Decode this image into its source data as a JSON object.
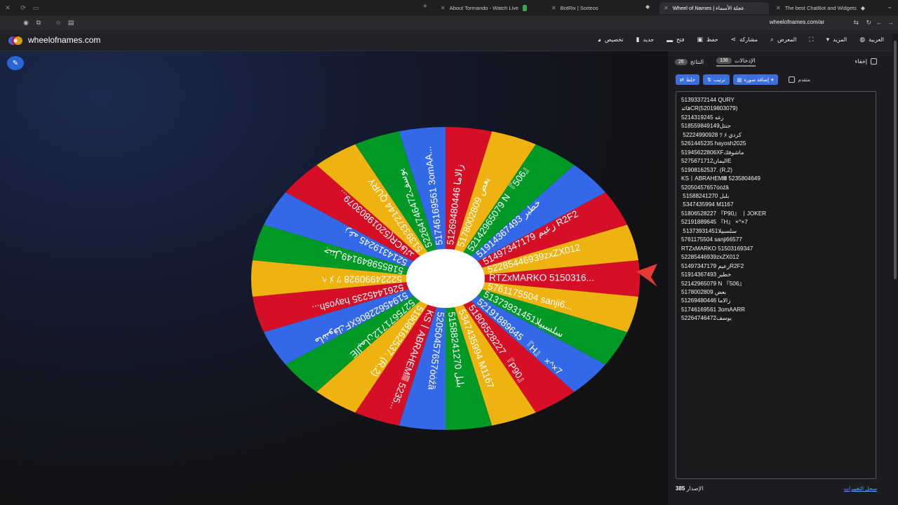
{
  "browser": {
    "tabs": [
      {
        "label": "About Tormando - Watch Live",
        "favicon_color": "#6a6a6a"
      },
      {
        "label": "BotRix | Sorteos",
        "favicon_color": "#3aa84a"
      },
      {
        "label": "Wheel of Names | عجلة الأسماء",
        "favicon_color": "#3369e8",
        "active": true
      },
      {
        "label": "The best ChatBot and Widgets",
        "favicon_color": "#888888"
      }
    ],
    "url": "wheelofnames.com/ar"
  },
  "header": {
    "brand": "wheelofnames.com",
    "menu": [
      {
        "label": "تخصيص",
        "icon": "palette-icon"
      },
      {
        "label": "جديد",
        "icon": "file-icon"
      },
      {
        "label": "فتح",
        "icon": "folder-icon"
      },
      {
        "label": "حفظ",
        "icon": "save-icon"
      },
      {
        "label": "مشاركة",
        "icon": "share-icon"
      },
      {
        "label": "المعرض",
        "icon": "search-icon"
      },
      {
        "label": "",
        "icon": "fullscreen-icon"
      },
      {
        "label": "المزيد",
        "icon": "caret-down-icon"
      },
      {
        "label": "العربية",
        "icon": "globe-icon"
      }
    ]
  },
  "wheel": {
    "pointer_color": "#e53935",
    "segment_colors": [
      "#3369e8",
      "#009925",
      "#eeb211",
      "#d50f25"
    ],
    "labels": [
      "RTZxMARKO 5150316...",
      "5761175504 sanji6...",
      "51373931451سلسبيلا",
      "52191889645 『H』 ×^×7",
      "51806528227 『P90』",
      "5347435994 M1167",
      "51588241270 بلبل",
      "52050457657ȯȯźȁ",
      "KS丨ABRAHEM𝄜 5235...",
      "51908162537. (R,2)",
      "5275671712اليمانE",
      "51945622806XFماشوفك",
      "5261445235 hayosh...",
      "52224990928 ﾂ ﾒ ﾍ",
      "518559849149جنتل",
      "5214319245 زغه",
      "قائدCR(52019803079...",
      "51393372144 QURY",
      "52264746472يوسف",
      "51746169561 3omAA...",
      "51269480446 زالاما",
      "5178002809 بعض",
      "52142965079 N 『506』",
      "51914367493 خطير",
      "51497347179 زعيم R2F2",
      "52285446939zxZX012"
    ]
  },
  "panel": {
    "hide_label": "إخفاء",
    "tabs": [
      {
        "label": "الإدخالات",
        "count": "136"
      },
      {
        "label": "النتائج",
        "count": "26"
      }
    ],
    "buttons": [
      {
        "label": "خلط",
        "icon": "shuffle-icon"
      },
      {
        "label": "ترتيب",
        "icon": "sort-icon"
      },
      {
        "label": "إضافة صورة",
        "icon": "image-icon"
      }
    ],
    "advanced_label": "متقدم",
    "entries": [
      "51393372144 QURY",
      "قائدCR(52019803079)",
      "5214319245 زغه",
      "518559849149جنتل",
      " 52224990928 ﾂ ﾒ كردي",
      "5261445235 hayosh2025",
      "51945622806XFماشوفك",
      "5275671712اليمانE",
      "51908162537. (R,2)",
      "KS丨ABRAHEM𝄜 5235804649",
      "52050457657ȯȯźȁ",
      " 51588241270 بلبل",
      " 5347435994 M1167",
      "51806528227 『P90』 丨JOKER",
      "52191889645 『H』 ×^×7",
      " 51373931451سلسبيلا",
      "5761175504 sanji66577",
      "RTZxMARKO 51503169347",
      "52285446939zxZX012",
      "51497347179 زعيمR2F2",
      "51914367493 خطير",
      "52142965079 N 『506』",
      "5178002809 بعض",
      "51269480446 زالاما",
      "51746169561 3omAARR",
      "52264746472يوسف"
    ],
    "version_label": "الإصدار",
    "version": "385",
    "changelog_label": "سجل التغييرات"
  }
}
